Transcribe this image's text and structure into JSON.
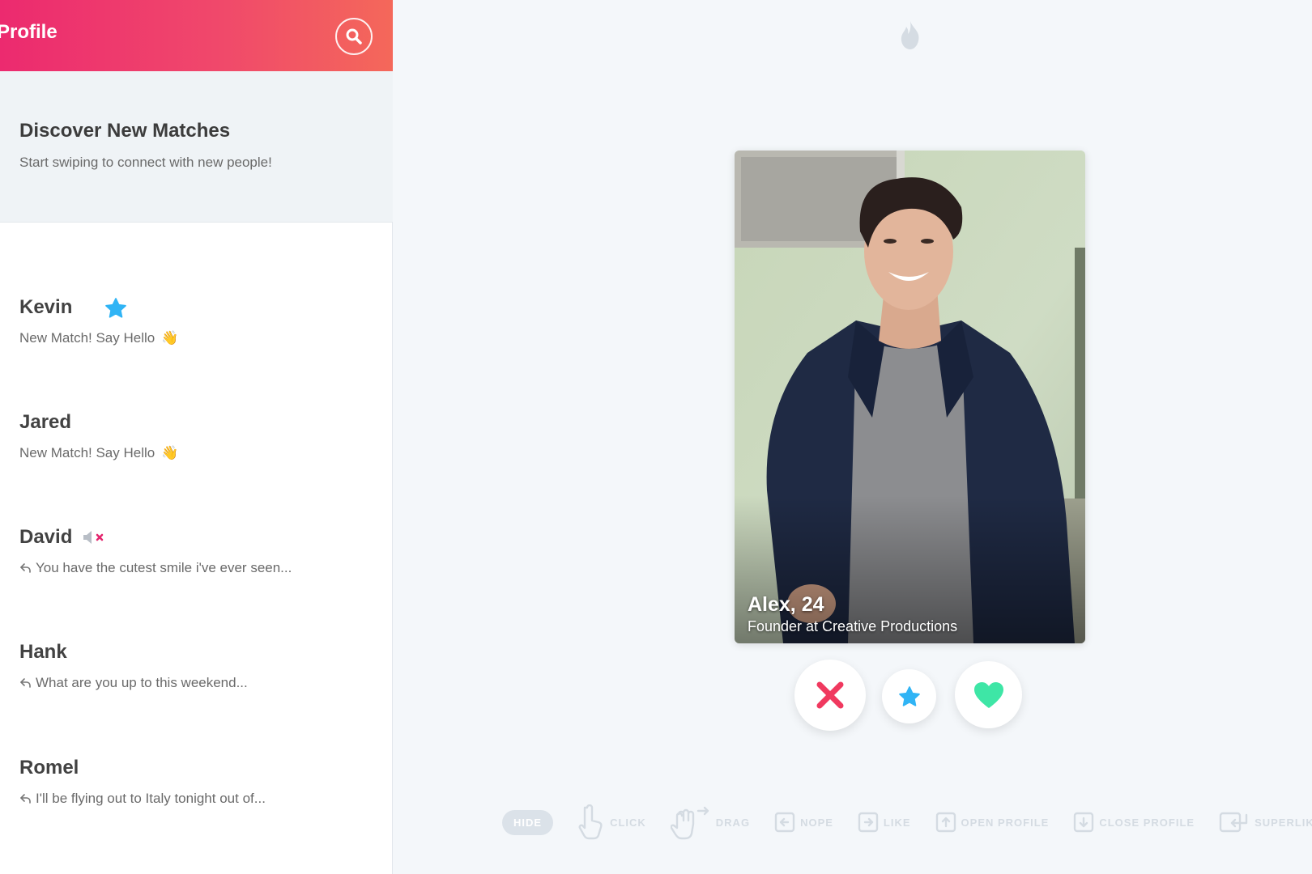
{
  "header": {
    "title": "Profile",
    "search_icon": "search-icon"
  },
  "discover": {
    "title": "Discover New Matches",
    "subtitle": "Start swiping to connect with new people!"
  },
  "matches": [
    {
      "name": "Kevin",
      "message": "New Match! Say Hello",
      "emoji": "👋",
      "super_like": true
    },
    {
      "name": "Jared",
      "message": "New Match! Say Hello",
      "emoji": "👋"
    },
    {
      "name": "David",
      "message": "You have the cutest smile i've ever seen...",
      "muted": true,
      "replied": true
    },
    {
      "name": "Hank",
      "message": "What are you up to this weekend...",
      "replied": true
    },
    {
      "name": "Romel",
      "message": "I'll be flying out to Italy tonight out of...",
      "replied": true
    }
  ],
  "profile_card": {
    "name_age": "Alex, 24",
    "job": "Founder at Creative Productions"
  },
  "actions": {
    "nope_icon": "x-icon",
    "superlike_icon": "star-icon",
    "like_icon": "heart-icon"
  },
  "hints": {
    "hide_label": "HIDE",
    "click_label": "CLICK",
    "drag_label": "DRAG",
    "nope_label": "NOPE",
    "like_label": "LIKE",
    "open_profile_label": "OPEN PROFILE",
    "close_profile_label": "CLOSE PROFILE",
    "superlike_label": "SUPERLIKE"
  },
  "colors": {
    "brand_pink": "#ec2a6f",
    "brand_orange": "#f4685a",
    "nope_red": "#f0395f",
    "superlike_blue": "#30b4f5",
    "like_green": "#3ee6a6"
  }
}
